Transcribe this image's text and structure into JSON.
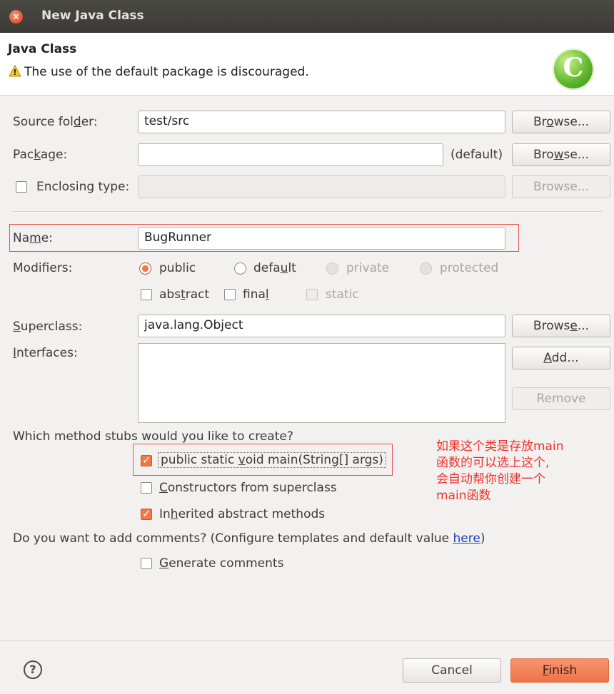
{
  "window": {
    "title": "New Java Class"
  },
  "header": {
    "title": "Java Class",
    "message": "The use of the default package is discouraged."
  },
  "source_folder": {
    "label": "Source folder:",
    "value": "test/src",
    "browse": "Browse..."
  },
  "package": {
    "label": "Package:",
    "value": "",
    "default_hint": "(default)",
    "browse": "Browse..."
  },
  "enclosing": {
    "label": "Enclosing type:",
    "value": "",
    "browse": "Browse...",
    "checked": false
  },
  "name": {
    "label": "Name:",
    "value": "BugRunner"
  },
  "modifiers": {
    "label": "Modifiers:",
    "options": [
      "public",
      "default",
      "private",
      "protected"
    ],
    "selected": "public",
    "abstract": "abstract",
    "final": "final",
    "static": "static"
  },
  "superclass": {
    "label": "Superclass:",
    "value": "java.lang.Object",
    "browse": "Browse..."
  },
  "interfaces": {
    "label": "Interfaces:",
    "add": "Add...",
    "remove": "Remove"
  },
  "stubs": {
    "question": "Which method stubs would you like to create?",
    "main": "public static void main(String[] args)",
    "constructors": "Constructors from superclass",
    "inherited": "Inherited abstract methods"
  },
  "comments": {
    "question_prefix": "Do you want to add comments? (Configure templates and default value ",
    "link": "here",
    "question_suffix": ")",
    "generate": "Generate comments"
  },
  "annotation": {
    "lines": [
      "如果这个类是存放main",
      "函数的可以选上这个,",
      "会自动帮你创建一个",
      "main函数"
    ]
  },
  "footer": {
    "cancel": "Cancel",
    "finish": "Finish"
  },
  "colors": {
    "accent": "#f07746",
    "annotation": "#f0312b",
    "link": "#1a3fc4"
  }
}
